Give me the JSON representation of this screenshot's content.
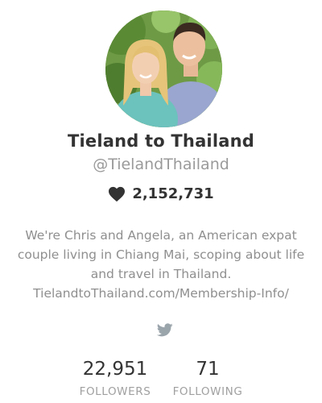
{
  "profile": {
    "name": "Tieland to Thailand",
    "handle": "@TielandThailand",
    "likes": "2,152,731",
    "bio_lines": [
      "We're Chris and Angela, an American expat",
      "couple living in Chiang Mai, scoping about life",
      "and travel in Thailand."
    ],
    "bio_link": "TielandtoThailand.com/Membership-Info/"
  },
  "stats": {
    "followers_value": "22,951",
    "followers_label": "FOLLOWERS",
    "following_value": "71",
    "following_label": "FOLLOWING"
  },
  "icons": {
    "likes": "heart-icon",
    "social": "twitter-icon"
  },
  "colors": {
    "text_primary": "#333333",
    "text_secondary": "#9a9a9a",
    "icon": "#9aa4ab"
  }
}
